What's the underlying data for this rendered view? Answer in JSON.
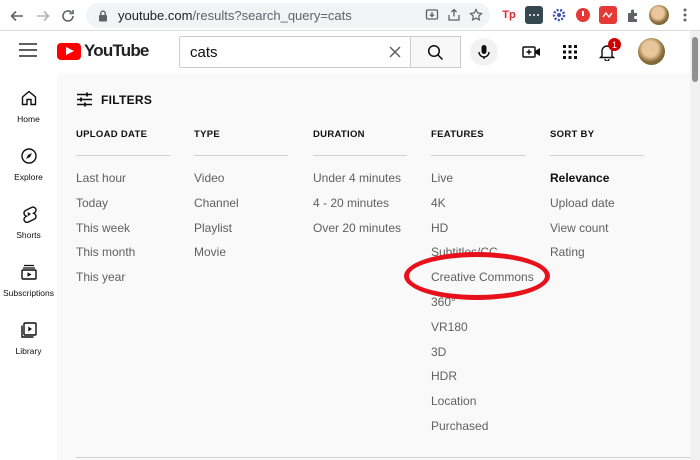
{
  "browser": {
    "url_host": "youtube.com",
    "url_path": "/results?search_query=cats"
  },
  "header": {
    "logo_text": "YouTube",
    "search_value": "cats",
    "notification_count": "1"
  },
  "guide": [
    {
      "label": "Home",
      "icon": "home-icon"
    },
    {
      "label": "Explore",
      "icon": "compass-icon"
    },
    {
      "label": "Shorts",
      "icon": "shorts-icon"
    },
    {
      "label": "Subscriptions",
      "icon": "subscriptions-icon"
    },
    {
      "label": "Library",
      "icon": "library-icon"
    }
  ],
  "filters": {
    "title": "FILTERS",
    "columns": [
      {
        "heading": "UPLOAD DATE",
        "options": [
          "Last hour",
          "Today",
          "This week",
          "This month",
          "This year"
        ]
      },
      {
        "heading": "TYPE",
        "options": [
          "Video",
          "Channel",
          "Playlist",
          "Movie"
        ]
      },
      {
        "heading": "DURATION",
        "options": [
          "Under 4 minutes",
          "4 - 20 minutes",
          "Over 20 minutes"
        ]
      },
      {
        "heading": "FEATURES",
        "options": [
          "Live",
          "4K",
          "HD",
          "Subtitles/CC",
          "Creative Commons",
          "360°",
          "VR180",
          "3D",
          "HDR",
          "Location",
          "Purchased"
        ]
      },
      {
        "heading": "SORT BY",
        "options": [
          "Relevance",
          "Upload date",
          "View count",
          "Rating"
        ],
        "selected": "Relevance"
      }
    ]
  },
  "colors": {
    "brand_red": "#ff0000",
    "highlight_red": "#e8101a",
    "text_secondary": "#606060"
  }
}
